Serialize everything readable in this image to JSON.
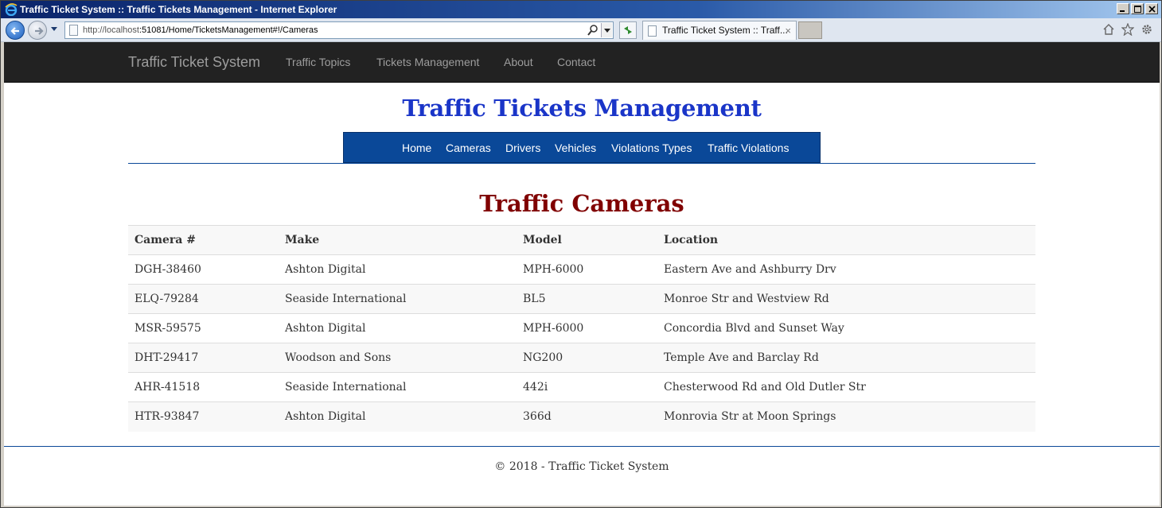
{
  "window": {
    "title": "Traffic Ticket System :: Traffic Tickets Management - Internet Explorer",
    "icon": "ie-icon"
  },
  "browser": {
    "address_host": "http://localhost",
    "address_path": ":51081/Home/TicketsManagement#!/Cameras",
    "tab_label": "Traffic Ticket System :: Traff...",
    "tab_close": "×"
  },
  "site": {
    "brand": "Traffic Ticket System",
    "nav": [
      "Traffic Topics",
      "Tickets Management",
      "About",
      "Contact"
    ]
  },
  "page": {
    "title": "Traffic Tickets Management",
    "sub_nav": [
      "Home",
      "Cameras",
      "Drivers",
      "Vehicles",
      "Violations Types",
      "Traffic Violations"
    ],
    "section_title": "Traffic Cameras"
  },
  "table": {
    "headers": [
      "Camera #",
      "Make",
      "Model",
      "Location"
    ],
    "rows": [
      [
        "DGH-38460",
        "Ashton Digital",
        "MPH-6000",
        "Eastern Ave and Ashburry Drv"
      ],
      [
        "ELQ-79284",
        "Seaside International",
        "BL5",
        "Monroe Str and Westview Rd"
      ],
      [
        "MSR-59575",
        "Ashton Digital",
        "MPH-6000",
        "Concordia Blvd and Sunset Way"
      ],
      [
        "DHT-29417",
        "Woodson and Sons",
        "NG200",
        "Temple Ave and Barclay Rd"
      ],
      [
        "AHR-41518",
        "Seaside International",
        "442i",
        "Chesterwood Rd and Old Dutler Str"
      ],
      [
        "HTR-93847",
        "Ashton Digital",
        "366d",
        "Monrovia Str at Moon Springs"
      ]
    ]
  },
  "footer": {
    "text": "© 2018 - Traffic Ticket System"
  },
  "colors": {
    "navbar": "#222222",
    "title_blue": "#1a35c8",
    "subnav_blue": "#0a4898",
    "section_red": "#800000"
  }
}
